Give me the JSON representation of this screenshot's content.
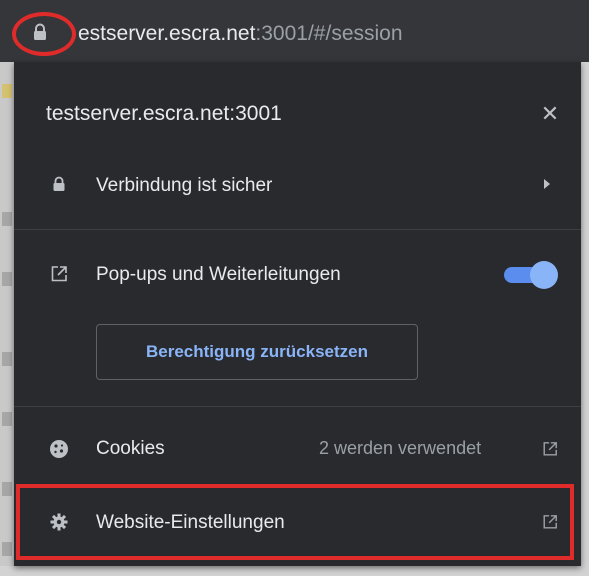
{
  "address_bar": {
    "url_host": "estserver.escra.net",
    "url_rest": ":3001/#/session"
  },
  "popup": {
    "title": "testserver.escra.net:3001",
    "close_label": "✕",
    "connection": {
      "label": "Verbindung ist sicher",
      "icon": "lock-icon"
    },
    "popups": {
      "label": "Pop-ups und Weiterleitungen",
      "icon": "external-link-icon",
      "toggle_on": true
    },
    "reset_button_label": "Berechtigung zurücksetzen",
    "cookies": {
      "label": "Cookies",
      "count": "2 werden verwendet",
      "icon": "cookie-icon"
    },
    "site_settings": {
      "label": "Website-Einstellungen",
      "icon": "gear-icon"
    }
  },
  "colors": {
    "background": "#292a2d",
    "accent": "#8ab4f8",
    "highlight_annotation": "#e02b2b"
  }
}
